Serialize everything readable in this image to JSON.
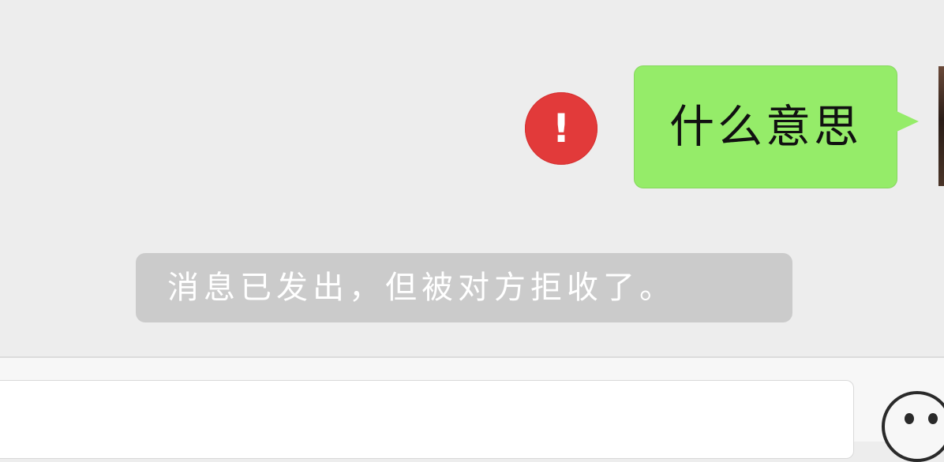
{
  "chat": {
    "messages": [
      {
        "direction": "outgoing",
        "text": "什么意思",
        "status": "failed",
        "bubble_color": "#95ec69"
      }
    ],
    "system_notice": "消息已发出，但被对方拒收了。",
    "error_icon": {
      "name": "exclamation-icon",
      "glyph": "!",
      "color": "#e23a3a"
    }
  },
  "input_bar": {
    "message_value": "",
    "emoji_icon": "emoji-icon"
  }
}
